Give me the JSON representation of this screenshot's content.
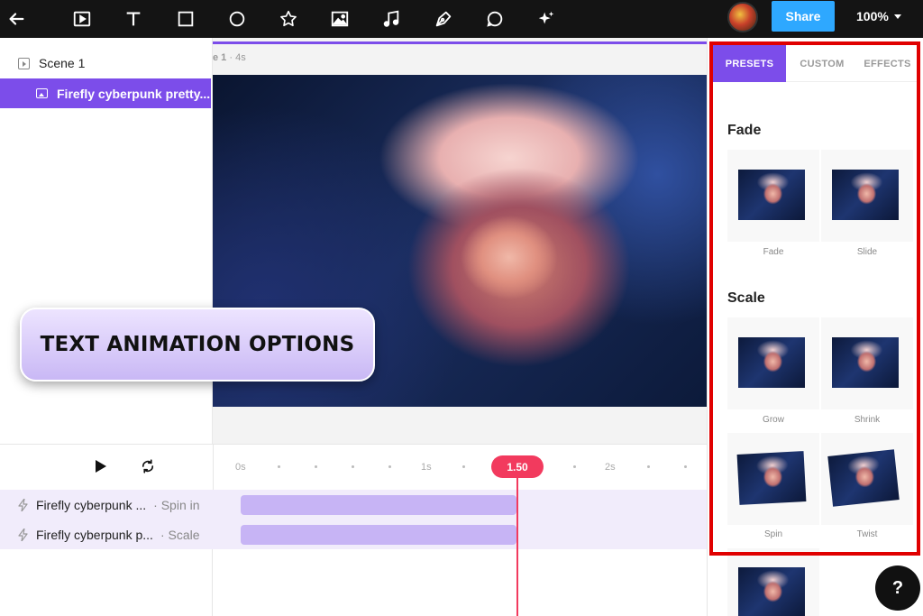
{
  "toolbar": {
    "icons": [
      "back-arrow-icon",
      "video-icon",
      "text-icon",
      "rectangle-icon",
      "circle-icon",
      "star-icon",
      "image-icon",
      "music-icon",
      "pen-icon",
      "comment-icon",
      "sparkle-icon"
    ],
    "share_label": "Share",
    "zoom": "100%"
  },
  "layers": {
    "scene_label": "Scene 1",
    "layer_label": "Firefly cyberpunk pretty..."
  },
  "canvas": {
    "scene_tag": "e 1",
    "scene_duration": "· 4s"
  },
  "callout": {
    "text": "TEXT ANIMATION OPTIONS"
  },
  "presets_panel": {
    "tabs": [
      "PRESETS",
      "CUSTOM",
      "EFFECTS"
    ],
    "active_tab": "PRESETS",
    "sections": [
      {
        "title": "Fade",
        "items": [
          "Fade",
          "Slide"
        ]
      },
      {
        "title": "Scale",
        "items": [
          "Grow",
          "Shrink",
          "Spin",
          "Twist"
        ]
      }
    ]
  },
  "help": {
    "label": "?"
  },
  "timeline": {
    "ticks": [
      "0s",
      "1s",
      "2s"
    ],
    "playhead": "1.50",
    "tracks": [
      {
        "name": "Firefly cyberpunk ...",
        "animation": "· Spin in"
      },
      {
        "name": "Firefly cyberpunk p...",
        "animation": "· Scale"
      }
    ]
  },
  "colors": {
    "accent": "#7c4dea",
    "share": "#2ea8ff",
    "playhead": "#f23a5e",
    "highlight_frame": "#e00000",
    "clip": "#c7b4f5"
  }
}
